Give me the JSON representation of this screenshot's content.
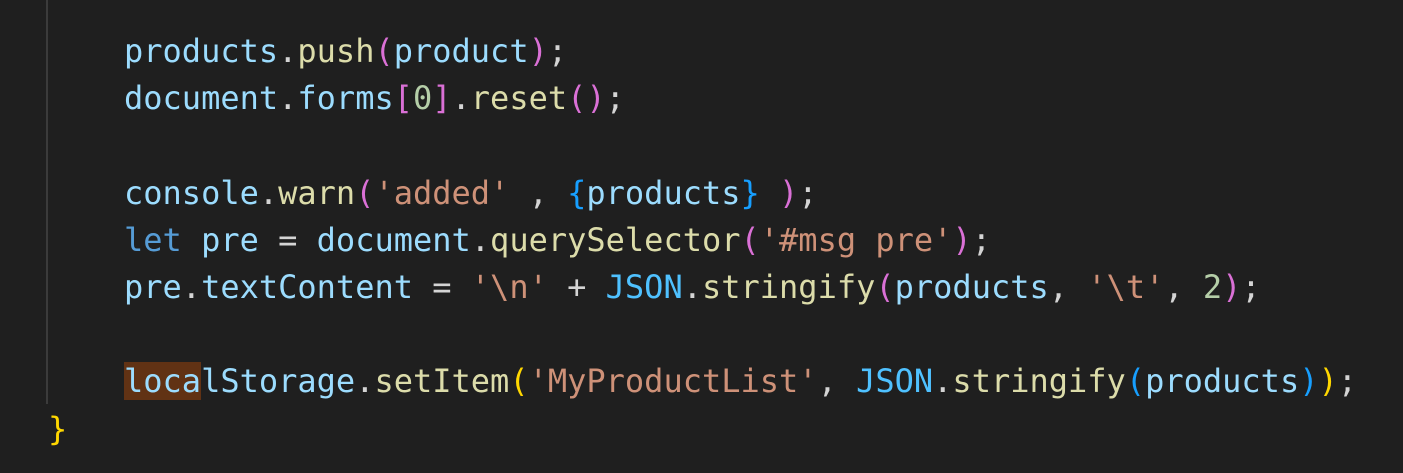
{
  "editor": {
    "lines": [
      {
        "tokens": [
          {
            "text": "products",
            "kind": "var"
          },
          {
            "text": ".",
            "kind": "op"
          },
          {
            "text": "push",
            "kind": "fn"
          },
          {
            "text": "(",
            "kind": "b2"
          },
          {
            "text": "product",
            "kind": "var"
          },
          {
            "text": ")",
            "kind": "b2"
          },
          {
            "text": ";",
            "kind": "op"
          }
        ]
      },
      {
        "tokens": [
          {
            "text": "document",
            "kind": "var"
          },
          {
            "text": ".",
            "kind": "op"
          },
          {
            "text": "forms",
            "kind": "var"
          },
          {
            "text": "[",
            "kind": "b2"
          },
          {
            "text": "0",
            "kind": "num"
          },
          {
            "text": "]",
            "kind": "b2"
          },
          {
            "text": ".",
            "kind": "op"
          },
          {
            "text": "reset",
            "kind": "fn"
          },
          {
            "text": "()",
            "kind": "b2"
          },
          {
            "text": ";",
            "kind": "op"
          }
        ]
      },
      {
        "tokens": []
      },
      {
        "tokens": [
          {
            "text": "console",
            "kind": "var"
          },
          {
            "text": ".",
            "kind": "op"
          },
          {
            "text": "warn",
            "kind": "fn"
          },
          {
            "text": "(",
            "kind": "b2"
          },
          {
            "text": "'added'",
            "kind": "str"
          },
          {
            "text": " , ",
            "kind": "op"
          },
          {
            "text": "{",
            "kind": "b3"
          },
          {
            "text": "products",
            "kind": "var"
          },
          {
            "text": "}",
            "kind": "b3"
          },
          {
            "text": " ",
            "kind": "op"
          },
          {
            "text": ")",
            "kind": "b2"
          },
          {
            "text": ";",
            "kind": "op"
          }
        ]
      },
      {
        "tokens": [
          {
            "text": "let",
            "kind": "kw"
          },
          {
            "text": " ",
            "kind": "op"
          },
          {
            "text": "pre",
            "kind": "var"
          },
          {
            "text": " = ",
            "kind": "op"
          },
          {
            "text": "document",
            "kind": "var"
          },
          {
            "text": ".",
            "kind": "op"
          },
          {
            "text": "querySelector",
            "kind": "fn"
          },
          {
            "text": "(",
            "kind": "b2"
          },
          {
            "text": "'#msg pre'",
            "kind": "str"
          },
          {
            "text": ")",
            "kind": "b2"
          },
          {
            "text": ";",
            "kind": "op"
          }
        ]
      },
      {
        "tokens": [
          {
            "text": "pre",
            "kind": "var"
          },
          {
            "text": ".",
            "kind": "op"
          },
          {
            "text": "textContent",
            "kind": "var"
          },
          {
            "text": " = ",
            "kind": "op"
          },
          {
            "text": "'\\n'",
            "kind": "str"
          },
          {
            "text": " + ",
            "kind": "op"
          },
          {
            "text": "JSON",
            "kind": "cls"
          },
          {
            "text": ".",
            "kind": "op"
          },
          {
            "text": "stringify",
            "kind": "fn"
          },
          {
            "text": "(",
            "kind": "b2"
          },
          {
            "text": "products",
            "kind": "var"
          },
          {
            "text": ", ",
            "kind": "op"
          },
          {
            "text": "'\\t'",
            "kind": "str"
          },
          {
            "text": ", ",
            "kind": "op"
          },
          {
            "text": "2",
            "kind": "num"
          },
          {
            "text": ")",
            "kind": "b2"
          },
          {
            "text": ";",
            "kind": "op"
          }
        ]
      },
      {
        "tokens": []
      },
      {
        "tokens": [
          {
            "text": "loca",
            "kind": "var",
            "highlight": true
          },
          {
            "text": "lStorage",
            "kind": "var"
          },
          {
            "text": ".",
            "kind": "op"
          },
          {
            "text": "setItem",
            "kind": "fn"
          },
          {
            "text": "(",
            "kind": "b1"
          },
          {
            "text": "'MyProductList'",
            "kind": "str"
          },
          {
            "text": ", ",
            "kind": "op"
          },
          {
            "text": "JSON",
            "kind": "cls"
          },
          {
            "text": ".",
            "kind": "op"
          },
          {
            "text": "stringify",
            "kind": "fn"
          },
          {
            "text": "(",
            "kind": "b3"
          },
          {
            "text": "products",
            "kind": "var"
          },
          {
            "text": ")",
            "kind": "b3"
          },
          {
            "text": ")",
            "kind": "b1"
          },
          {
            "text": ";",
            "kind": "op"
          }
        ]
      },
      {
        "tokens": [
          {
            "text": "}",
            "kind": "b1"
          }
        ]
      }
    ]
  }
}
